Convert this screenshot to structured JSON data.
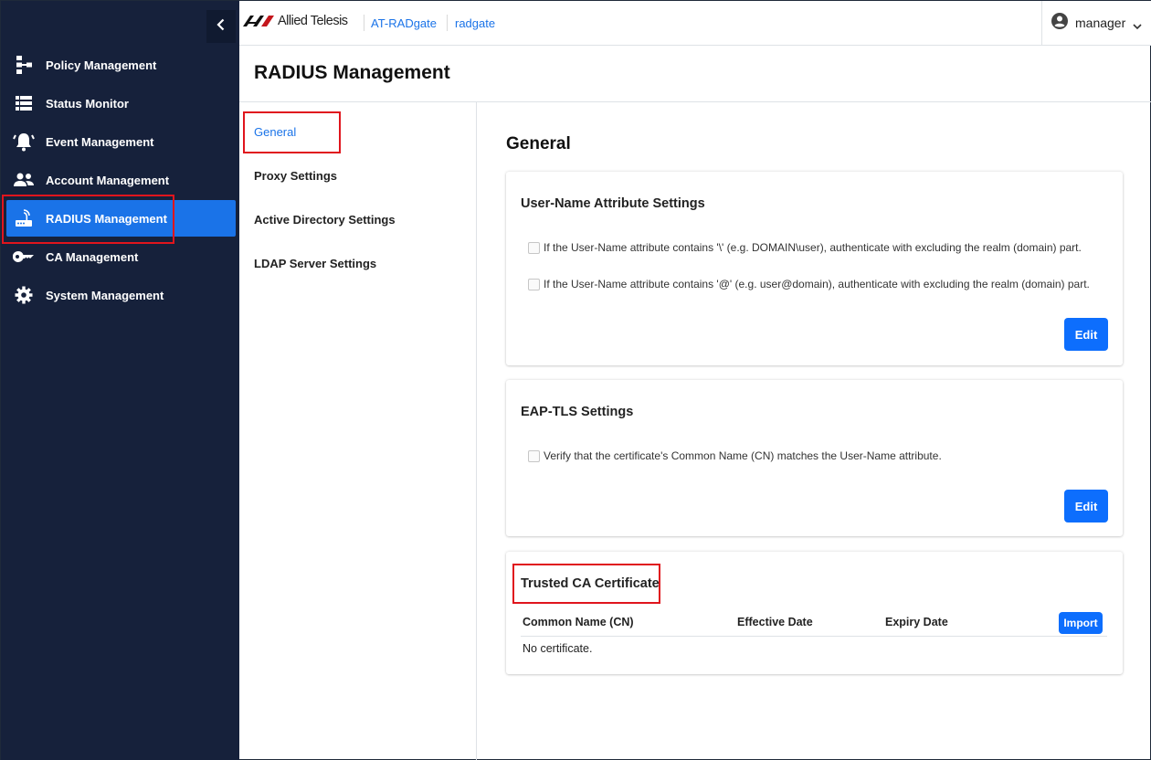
{
  "sidebar": {
    "collapse_icon": "chevron-left-icon",
    "items": [
      {
        "label": "Policy Management",
        "icon": "sitemap-icon"
      },
      {
        "label": "Status Monitor",
        "icon": "list-icon"
      },
      {
        "label": "Event Management",
        "icon": "bell-icon"
      },
      {
        "label": "Account Management",
        "icon": "users-icon"
      },
      {
        "label": "RADIUS Management",
        "icon": "router-icon",
        "active": true
      },
      {
        "label": "CA Management",
        "icon": "key-icon"
      },
      {
        "label": "System Management",
        "icon": "gear-icon"
      }
    ]
  },
  "header": {
    "brand": "Allied Telesis",
    "breadcrumbs": [
      "AT-RADgate",
      "radgate"
    ],
    "user": "manager"
  },
  "page": {
    "title": "RADIUS Management"
  },
  "subnav": {
    "items": [
      {
        "label": "General",
        "active": true
      },
      {
        "label": "Proxy Settings"
      },
      {
        "label": "Active Directory Settings"
      },
      {
        "label": "LDAP Server Settings"
      }
    ]
  },
  "main": {
    "title": "General",
    "username_card": {
      "title": "User-Name Attribute Settings",
      "options": [
        {
          "label": "If the User-Name attribute contains '\\' (e.g. DOMAIN\\user), authenticate with excluding the realm (domain) part.",
          "checked": false
        },
        {
          "label": "If the User-Name attribute contains '@' (e.g. user@domain), authenticate with excluding the realm (domain) part.",
          "checked": false
        }
      ],
      "edit_label": "Edit"
    },
    "eaptls_card": {
      "title": "EAP-TLS Settings",
      "options": [
        {
          "label": "Verify that the certificate's Common Name (CN) matches the User-Name attribute.",
          "checked": false
        }
      ],
      "edit_label": "Edit"
    },
    "ca_card": {
      "title": "Trusted CA Certificate",
      "columns": [
        "Common Name (CN)",
        "Effective Date",
        "Expiry Date"
      ],
      "import_label": "Import",
      "empty_text": "No certificate."
    }
  },
  "colors": {
    "sidebar_bg": "#16213b",
    "accent": "#1a73e8",
    "button": "#0d6efd",
    "highlight": "#e0151d"
  }
}
